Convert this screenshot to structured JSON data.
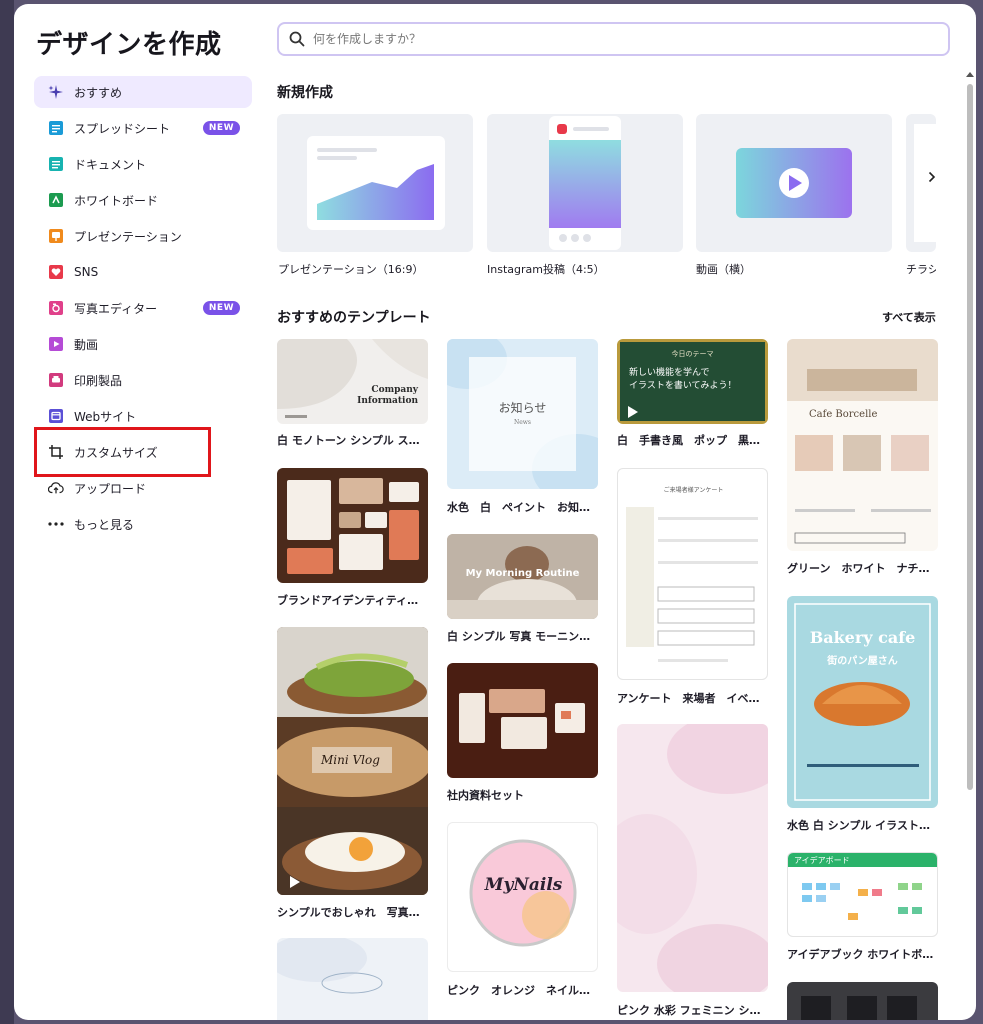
{
  "dialog": {
    "title": "デザインを作成",
    "search_placeholder": "何を作成しますか？"
  },
  "nav": [
    {
      "label": "おすすめ",
      "icon": "sparkle-icon",
      "active": true
    },
    {
      "label": "スプレッドシート",
      "icon": "spreadsheet-icon",
      "badge": "NEW"
    },
    {
      "label": "ドキュメント",
      "icon": "document-icon"
    },
    {
      "label": "ホワイトボード",
      "icon": "whiteboard-icon"
    },
    {
      "label": "プレゼンテーション",
      "icon": "presentation-icon"
    },
    {
      "label": "SNS",
      "icon": "heart-icon"
    },
    {
      "label": "写真エディター",
      "icon": "camera-icon",
      "badge": "NEW"
    },
    {
      "label": "動画",
      "icon": "video-icon"
    },
    {
      "label": "印刷製品",
      "icon": "printer-icon"
    },
    {
      "label": "Webサイト",
      "icon": "website-icon"
    },
    {
      "label": "カスタムサイズ",
      "icon": "custom-size-icon"
    },
    {
      "label": "アップロード",
      "icon": "cloud-upload-icon"
    },
    {
      "label": "もっと見る",
      "icon": "more-dots-icon"
    }
  ],
  "new_section": {
    "title": "新規作成",
    "items": [
      {
        "label": "プレゼンテーション（16:9）"
      },
      {
        "label": "Instagram投稿（4:5）"
      },
      {
        "label": "動画（横）"
      },
      {
        "label": "チラシ"
      }
    ]
  },
  "templates_section": {
    "title": "おすすめのテンプレート",
    "show_all": "すべて表示",
    "items": [
      {
        "label": "白 モノトーン シンプル ス…",
        "thumb_text": "Company\nInformation"
      },
      {
        "label": "ブランドアイデンティティ…"
      },
      {
        "label": "シンプルでおしゃれ　写真…",
        "thumb_text": "Mini Vlog"
      },
      {
        "label": "水色　白　ペイント　お知…",
        "thumb_text": "お知らせ",
        "thumb_sub": "News"
      },
      {
        "label": "白 シンプル 写真 モーニン…",
        "thumb_text": "My Morning Routine"
      },
      {
        "label": "社内資料セット"
      },
      {
        "label": "ピンク　オレンジ　ネイル…",
        "thumb_text": "MyNails"
      },
      {
        "label": "白　手書き風　ポップ　黒…",
        "thumb_text": "今日のテーマ",
        "thumb_sub": "新しい機能を学んで\nイラストを書いてみよう！"
      },
      {
        "label": "アンケート　来場者　イベ…",
        "thumb_text": "ご来場者様アンケート"
      },
      {
        "label": "ピンク 水彩 フェミニン シ…"
      },
      {
        "label": "グリーン　ホワイト　ナチ…",
        "thumb_text": "Cafe Borcelle"
      },
      {
        "label": "水色 白 シンプル イラスト…",
        "thumb_text": "Bakery cafe",
        "thumb_sub": "街のパン屋さん"
      },
      {
        "label": "アイデアブック ホワイトボ…",
        "thumb_text": "アイデアボード"
      }
    ]
  },
  "colors": {
    "accent": "#7a52e8",
    "highlight": "#e0161b"
  }
}
